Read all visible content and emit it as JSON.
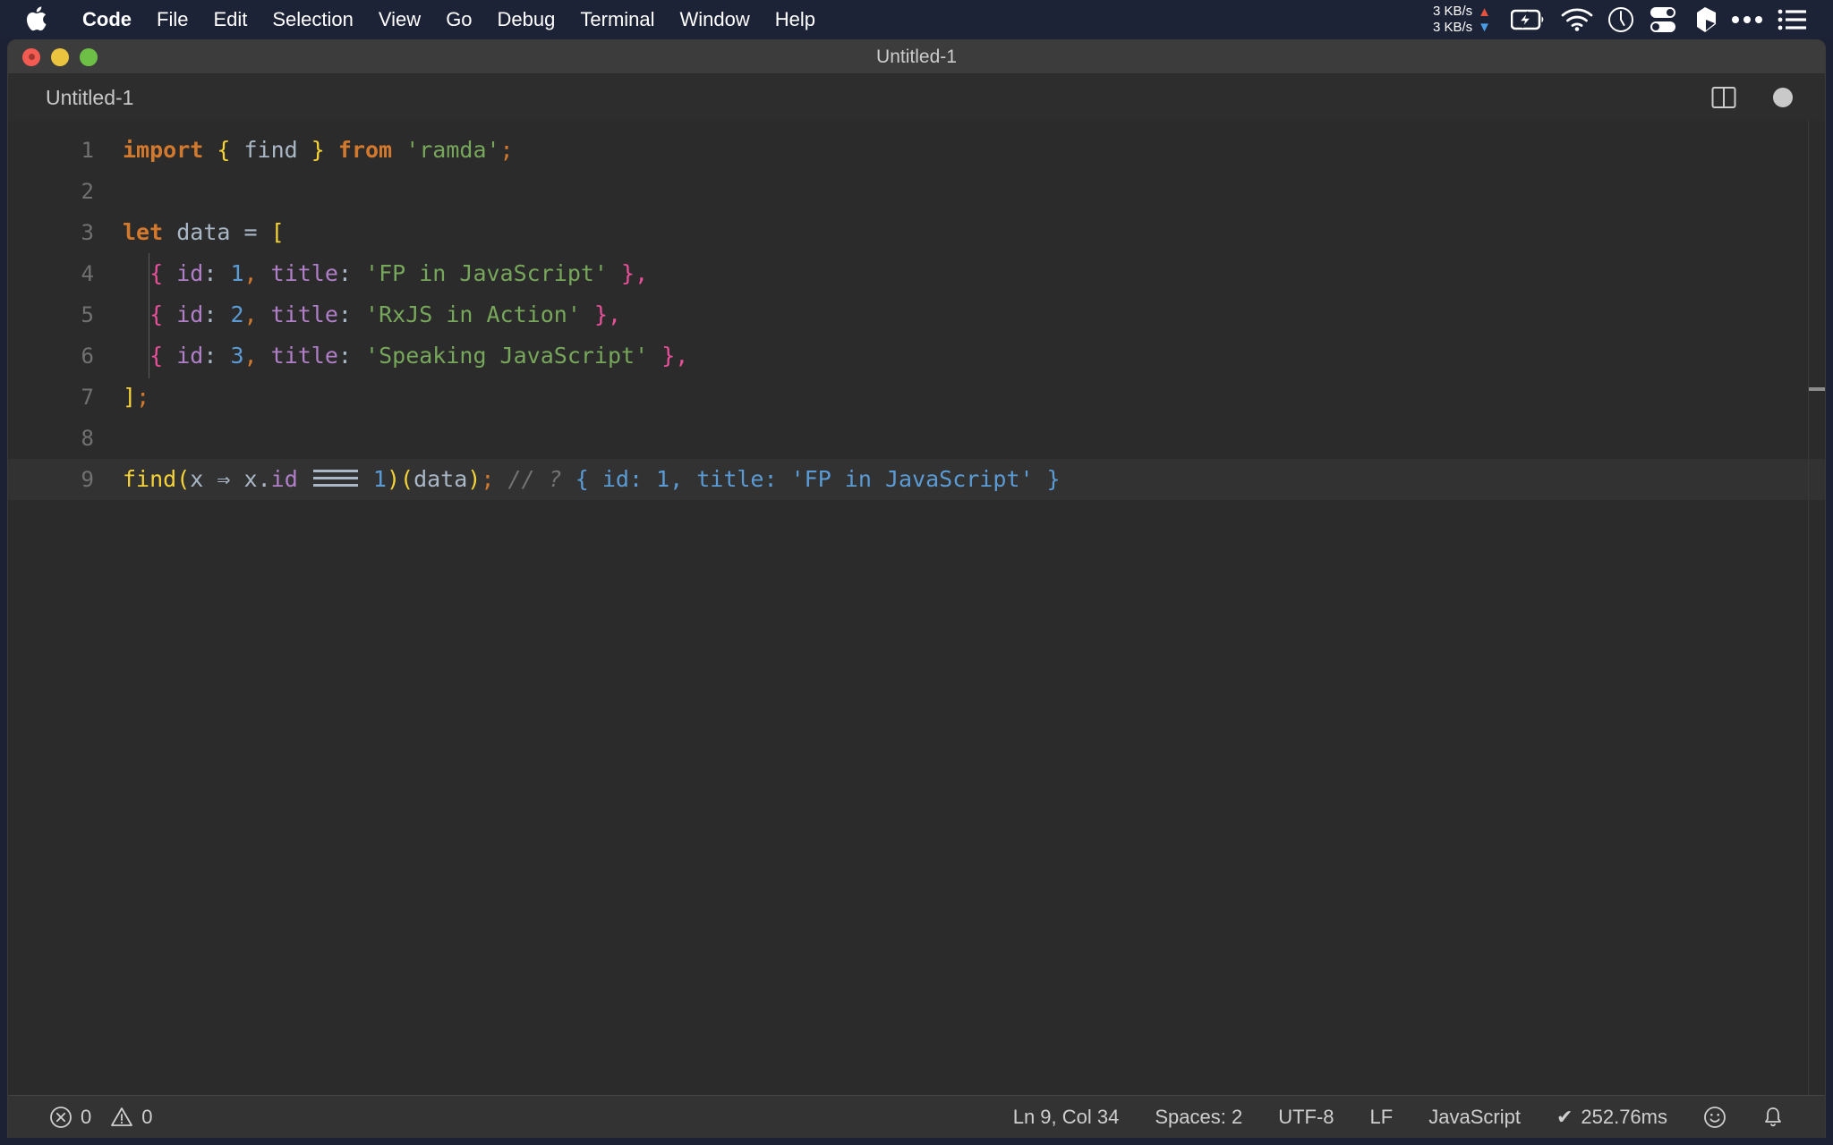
{
  "menubar": {
    "apple_icon": "apple-logo-icon",
    "items": [
      {
        "label": "Code",
        "bold": true
      },
      {
        "label": "File",
        "bold": false
      },
      {
        "label": "Edit",
        "bold": false
      },
      {
        "label": "Selection",
        "bold": false
      },
      {
        "label": "View",
        "bold": false
      },
      {
        "label": "Go",
        "bold": false
      },
      {
        "label": "Debug",
        "bold": false
      },
      {
        "label": "Terminal",
        "bold": false
      },
      {
        "label": "Window",
        "bold": false
      },
      {
        "label": "Help",
        "bold": false
      }
    ],
    "network": {
      "upload": "3 KB/s",
      "download": "3 KB/s",
      "up_arrow": "▲",
      "down_arrow": "▼",
      "up_color": "#e8523f",
      "down_color": "#4a9ee8"
    },
    "tray_icons": [
      "battery-charging-icon",
      "wifi-icon",
      "clock-icon",
      "toggles-icon",
      "shape-icon",
      "ellipsis-icon",
      "list-menu-icon"
    ]
  },
  "window": {
    "title": "Untitled-1",
    "traffic_lights": [
      "close-button",
      "minimize-button",
      "maximize-button"
    ]
  },
  "tab": {
    "label": "Untitled-1",
    "split_icon": "split-editor-icon",
    "dirty_indicator": "unsaved-changes-dot"
  },
  "editor": {
    "lines": [
      {
        "num": "1",
        "coverage": false,
        "current": false
      },
      {
        "num": "2",
        "coverage": false,
        "current": false
      },
      {
        "num": "3",
        "coverage": true,
        "current": false
      },
      {
        "num": "4",
        "coverage": false,
        "current": false
      },
      {
        "num": "5",
        "coverage": false,
        "current": false
      },
      {
        "num": "6",
        "coverage": false,
        "current": false
      },
      {
        "num": "7",
        "coverage": false,
        "current": false
      },
      {
        "num": "8",
        "coverage": false,
        "current": false
      },
      {
        "num": "9",
        "coverage": true,
        "current": true
      }
    ],
    "code": {
      "l1": {
        "kw_import": "import",
        "brace_open": "{",
        "ident_find": "find",
        "brace_close": "}",
        "kw_from": "from",
        "str_ramda": "'ramda'",
        "semi": ";"
      },
      "l3": {
        "kw_let": "let",
        "ident_data": "data",
        "eq": "=",
        "bracket": "["
      },
      "l4": {
        "objbr_open": "{",
        "prop_id": "id",
        "colon1": ":",
        "num": "1",
        "comma1": ",",
        "prop_title": "title",
        "colon2": ":",
        "str": "'FP in JavaScript'",
        "objbr_close": "}",
        "comma2": ","
      },
      "l5": {
        "objbr_open": "{",
        "prop_id": "id",
        "colon1": ":",
        "num": "2",
        "comma1": ",",
        "prop_title": "title",
        "colon2": ":",
        "str": "'RxJS in Action'",
        "objbr_close": "}",
        "comma2": ","
      },
      "l6": {
        "objbr_open": "{",
        "prop_id": "id",
        "colon1": ":",
        "num": "3",
        "comma1": ",",
        "prop_title": "title",
        "colon2": ":",
        "str": "'Speaking JavaScript'",
        "objbr_close": "}",
        "comma2": ","
      },
      "l7": {
        "bracket": "]",
        "semi": ";"
      },
      "l9": {
        "fn": "find",
        "paren_open": "(",
        "param": "x",
        "arrow": "⇒",
        "obj": "x",
        "dot": ".",
        "prop": "id",
        "strict_eq": "===",
        "num": "1",
        "paren_close": ")",
        "paren_open2": "(",
        "arg": "data",
        "paren_close2": ")",
        "semi": ";",
        "comment": "// ?",
        "result": "{ id: 1, title: 'FP in JavaScript' }"
      }
    }
  },
  "statusbar": {
    "error_icon": "error-circle-icon",
    "error_count": "0",
    "warning_icon": "warning-triangle-icon",
    "warning_count": "0",
    "cursor_position": "Ln 9, Col 34",
    "indentation": "Spaces: 2",
    "encoding": "UTF-8",
    "line_ending": "LF",
    "language": "JavaScript",
    "run_check": "✔",
    "run_time": "252.76ms",
    "feedback_icon": "smiley-icon",
    "notifications_icon": "bell-icon"
  },
  "colors": {
    "menubar_bg": "#1d2337",
    "titlebar_bg": "#3c3c3c",
    "editor_bg": "#2b2b2b",
    "tabstrip_bg": "#2d2d2d",
    "statusbar_bg": "#333333",
    "coverage_green": "#5dbf51",
    "keyword_orange": "#d2792d",
    "string_green": "#77a75a",
    "brace_yellow": "#f6d337",
    "property_purple": "#b07fc7",
    "number_blue": "#5b9bd5",
    "object_brace_pink": "#e8509a",
    "result_blue": "#5b9bd5"
  }
}
